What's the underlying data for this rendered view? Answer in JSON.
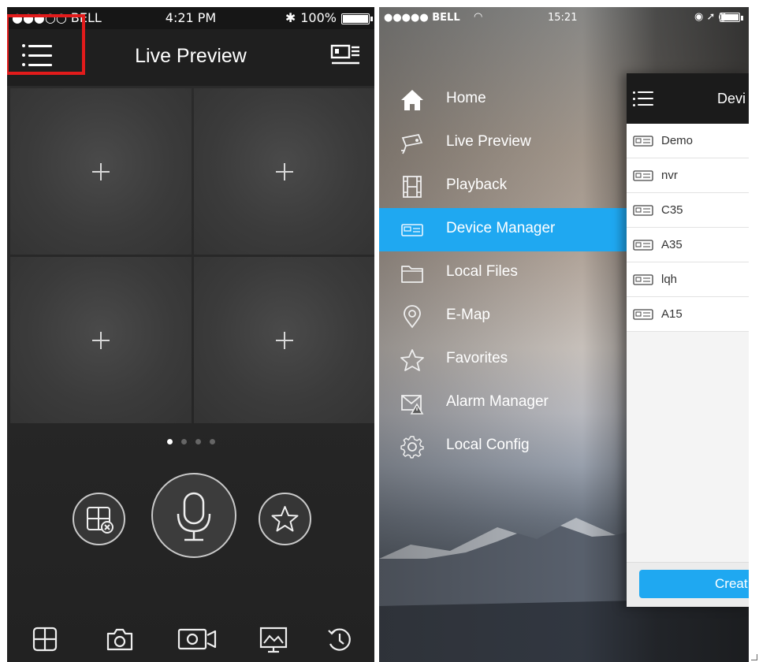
{
  "left_screen": {
    "status_bar": {
      "carrier": "●●●○○ BELL",
      "time": "4:21 PM",
      "battery": "100%"
    },
    "nav": {
      "title": "Live Preview"
    },
    "pager": {
      "pages": 4,
      "current": 1
    }
  },
  "right_screen": {
    "status_bar": {
      "carrier": "●●●●● BELL",
      "time": "15:21"
    },
    "menu": [
      {
        "label": "Home",
        "icon": "home-icon"
      },
      {
        "label": "Live Preview",
        "icon": "camera-icon"
      },
      {
        "label": "Playback",
        "icon": "film-icon"
      },
      {
        "label": "Device Manager",
        "icon": "dvr-icon",
        "active": true
      },
      {
        "label": "Local Files",
        "icon": "folder-icon"
      },
      {
        "label": "E-Map",
        "icon": "map-pin-icon"
      },
      {
        "label": "Favorites",
        "icon": "star-icon"
      },
      {
        "label": "Alarm Manager",
        "icon": "alarm-mail-icon"
      },
      {
        "label": "Local Config",
        "icon": "gear-icon"
      }
    ],
    "device_panel": {
      "title": "Devi",
      "devices": [
        "Demo",
        "nvr",
        "C35",
        "A35",
        "lqh",
        "A15"
      ],
      "create_label": "Creat"
    }
  },
  "colors": {
    "accent": "#1fa8f1",
    "highlight_box": "#e21b1b"
  }
}
